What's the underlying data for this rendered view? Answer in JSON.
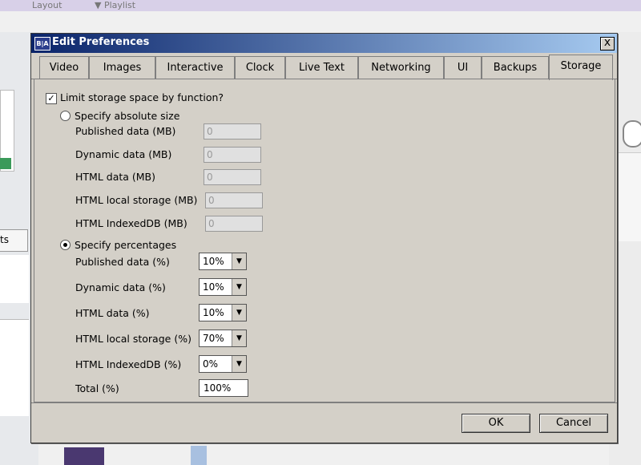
{
  "background": {
    "top_left_text": "Layout",
    "top_right_text": "▼ Playlist",
    "left_tab_label": "ts"
  },
  "dialog": {
    "icon_text": "B|A",
    "title": "Edit Preferences",
    "close_label": "x",
    "tabs": [
      {
        "label": "Video"
      },
      {
        "label": "Images"
      },
      {
        "label": "Interactive"
      },
      {
        "label": "Clock"
      },
      {
        "label": "Live Text"
      },
      {
        "label": "Networking"
      },
      {
        "label": "UI"
      },
      {
        "label": "Backups"
      },
      {
        "label": "Storage"
      }
    ],
    "active_tab": "Storage",
    "limit_checkbox": {
      "label": "Limit storage space by function?",
      "checked": true
    },
    "absolute": {
      "label": "Specify absolute size",
      "selected": false,
      "fields": [
        {
          "label": "Published data (MB)",
          "value": "0"
        },
        {
          "label": "Dynamic data (MB)",
          "value": "0"
        },
        {
          "label": "HTML data (MB)",
          "value": "0"
        },
        {
          "label": "HTML local storage (MB)",
          "value": "0"
        },
        {
          "label": "HTML IndexedDB (MB)",
          "value": "0"
        }
      ]
    },
    "percent": {
      "label": "Specify percentages",
      "selected": true,
      "fields": [
        {
          "label": "Published data (%)",
          "value": "10%"
        },
        {
          "label": "Dynamic data (%)",
          "value": "10%"
        },
        {
          "label": "HTML data (%)",
          "value": "10%"
        },
        {
          "label": "HTML local storage (%)",
          "value": "70%"
        },
        {
          "label": "HTML IndexedDB (%)",
          "value": "0%"
        }
      ],
      "total_label": "Total (%)",
      "total_value": "100%"
    },
    "ok_label": "OK",
    "cancel_label": "Cancel"
  }
}
